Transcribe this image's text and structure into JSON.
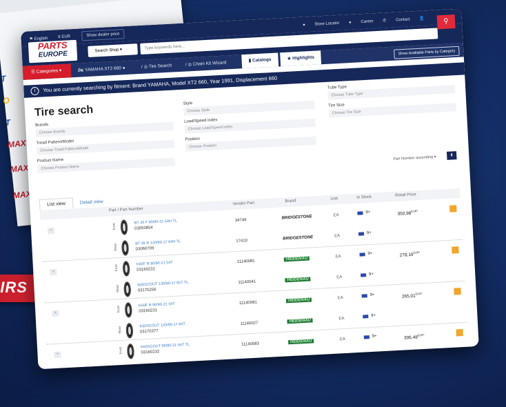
{
  "bg": {
    "brands": [
      {
        "text": "T",
        "color": "#1f54a8"
      },
      {
        "text": "O",
        "color": "#f0b51a"
      },
      {
        "text": "T",
        "color": "#1f54a8"
      },
      {
        "text": "MAX",
        "color": "#c41b2a"
      },
      {
        "text": "MAX",
        "color": "#c41b2a"
      },
      {
        "text": "MAX",
        "color": "#c41b2a"
      }
    ]
  },
  "ribbon": {
    "text": "IRS"
  },
  "topnav": {
    "language": "English",
    "currency": "€ EUR",
    "dealer_price": "Show dealer price",
    "store_locator": "Store Locator",
    "career": "Career",
    "contact": "Contact"
  },
  "header": {
    "logo_line1": "PARTS",
    "logo_line2": "EUROPE",
    "shop_select": "Search Shop",
    "search_placeholder": "Type keywords here..."
  },
  "tabs": {
    "categories": "Categories",
    "vehicle": "YAMAHA XT2 660",
    "tire_search": "Tire Search",
    "chain_kit": "Chain Kit Wizard",
    "catalogs": "Catalogs",
    "highlights": "Highlights",
    "show_parts": "Show Available Parts by Category"
  },
  "info": {
    "text": "You are currently searching by fitment: Brand YAMAHA, Model XT2 660, Year 1991, Displacement 660"
  },
  "form": {
    "title": "Tire search",
    "brands_label": "Brands",
    "brands_ph": "Choose Brands",
    "tread_label": "Tread Pattern/Model",
    "tread_ph": "Choose Tread Pattern/Model",
    "product_label": "Product Name",
    "product_ph": "Choose Product Name",
    "style_label": "Style",
    "style_ph": "Choose Style",
    "load_label": "Load/Speed index",
    "load_ph": "Choose Load/Speed index",
    "position_label": "Position",
    "position_ph": "Choose Position",
    "tubetype_label": "Tube Type",
    "tubetype_ph": "Choose Tube Type",
    "tiresize_label": "Tire Size",
    "tiresize_ph": "Choose Tire Size",
    "sort": "Part Number ascending"
  },
  "view": {
    "list": "List view",
    "detail": "Detail view"
  },
  "table": {
    "headers": [
      "Part / Part Number",
      "Vendor Part",
      "Brand",
      "Unit",
      "In Stock",
      "Retail Price"
    ],
    "rows": [
      {
        "side": "front",
        "name": "BT 45 F 90/90-21 54H TL",
        "code": "03050854",
        "vendor": "34749",
        "brand": "BRIDGESTONE",
        "unit": "EA",
        "stock": "9+",
        "price": "350,98",
        "cur": "EUR*"
      },
      {
        "side": "Rear",
        "name": "BT 45 R 120/90-17 64H TL",
        "code": "03060709",
        "vendor": "17410",
        "brand": "BRIDGESTONE",
        "unit": "EA",
        "stock": "9+",
        "price": "",
        "cur": ""
      },
      {
        "side": "front",
        "name": "K60F R 90/90-21 54T",
        "code": "03160231",
        "vendor": "11140081",
        "brand": "HEIDENAU",
        "unit": "EA",
        "stock": "9+",
        "price": "278,16",
        "cur": "EUR*"
      },
      {
        "side": "Rear",
        "name": "K60SCOUT 130/80-17 65T TL",
        "code": "03170256",
        "vendor": "11140041",
        "brand": "HEIDENAU",
        "unit": "EA",
        "stock": "9+",
        "price": "",
        "cur": ""
      },
      {
        "side": "front",
        "name": "K60F R 90/90-21 54T",
        "code": "03160231",
        "vendor": "11140081",
        "brand": "HEIDENAU",
        "unit": "EA",
        "stock": "9+",
        "price": "265,01",
        "cur": "EUR*"
      },
      {
        "side": "Rear",
        "name": "K60SCOUT 120/90-17 64T",
        "code": "03170377",
        "vendor": "11140027",
        "brand": "HEIDENAU",
        "unit": "EA",
        "stock": "9+",
        "price": "",
        "cur": ""
      },
      {
        "side": "front",
        "name": "K60SCOUT 90/90-21 54T TL",
        "code": "03160232",
        "vendor": "11140083",
        "brand": "HEIDENAU",
        "unit": "EA",
        "stock": "9+",
        "price": "306,48",
        "cur": "EUR*"
      }
    ]
  }
}
